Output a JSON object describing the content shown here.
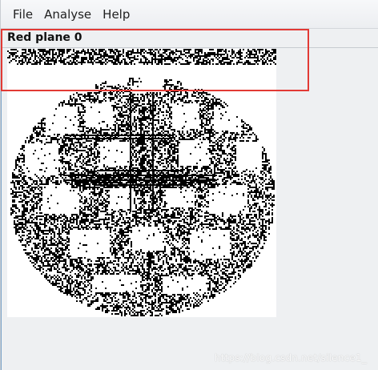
{
  "menubar": {
    "items": [
      {
        "label": "File"
      },
      {
        "label": "Analyse"
      },
      {
        "label": "Help"
      }
    ]
  },
  "panel": {
    "title": "Red plane 0"
  },
  "image": {
    "name": "noisy-bit-plane-image"
  },
  "watermark": {
    "text": "https://blog.csdn.net/silence1_"
  }
}
